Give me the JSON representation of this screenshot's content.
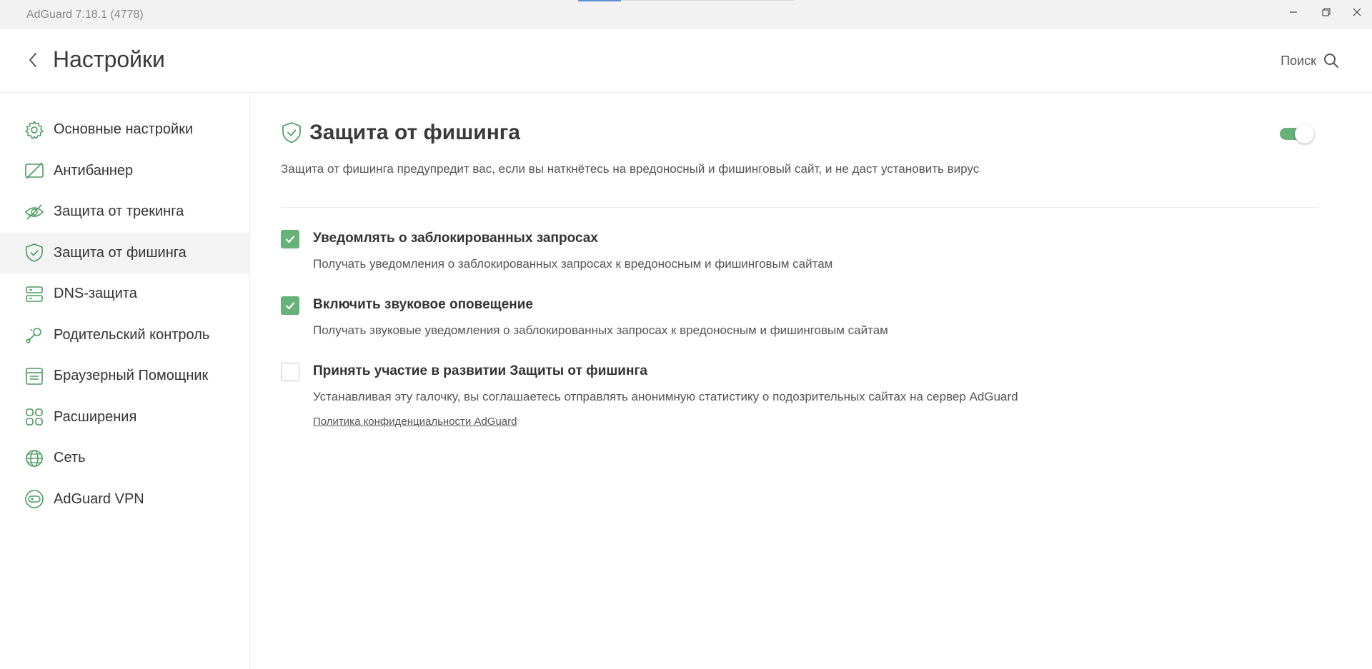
{
  "window": {
    "title": "AdGuard 7.18.1 (4778)",
    "controls": [
      "minimize-icon",
      "restore-icon",
      "close-icon"
    ]
  },
  "header": {
    "title": "Настройки",
    "back_icon": "chevron-left-icon",
    "search_label": "Поиск",
    "search_icon": "search-icon"
  },
  "sidebar": {
    "items": [
      {
        "label": "Основные настройки",
        "icon": "gear-icon",
        "active": false
      },
      {
        "label": "Антибаннер",
        "icon": "ad-block-icon",
        "active": false
      },
      {
        "label": "Защита от трекинга",
        "icon": "eye-off-icon",
        "active": false
      },
      {
        "label": "Защита от фишинга",
        "icon": "shield-check-icon",
        "active": true
      },
      {
        "label": "DNS-защита",
        "icon": "server-icon",
        "active": false
      },
      {
        "label": "Родительский контроль",
        "icon": "rattle-icon",
        "active": false
      },
      {
        "label": "Браузерный Помощник",
        "icon": "browser-icon",
        "active": false
      },
      {
        "label": "Расширения",
        "icon": "grid-icon",
        "active": false
      },
      {
        "label": "Сеть",
        "icon": "globe-icon",
        "active": false
      },
      {
        "label": "AdGuard VPN",
        "icon": "vpn-icon",
        "active": false
      }
    ]
  },
  "main": {
    "section_title": "Защита от фишинга",
    "section_icon": "shield-check-icon",
    "enabled": true,
    "description": "Защита от фишинга предупредит вас, если вы наткнётесь на вредоносный и фишинговый сайт, и не даст установить вирус",
    "options": [
      {
        "title": "Уведомлять о заблокированных запросах",
        "description": "Получать уведомления о заблокированных запросах к вредоносным и фишинговым сайтам",
        "checked": true
      },
      {
        "title": "Включить звуковое оповещение",
        "description": "Получать звуковые уведомления о заблокированных запросах к вредоносным и фишинговым сайтам",
        "checked": true
      },
      {
        "title": "Принять участие в развитии Защиты от фишинга",
        "description": "Устанавливая эту галочку, вы соглашаетесь отправлять анонимную статистику о подозрительных сайтах на сервер AdGuard",
        "link": "Политика конфиденциальности AdGuard",
        "checked": false
      }
    ]
  },
  "colors": {
    "accent": "#67b279",
    "icon_green": "#4c9a62",
    "active_bg": "#f3f3f3",
    "titlebar_bg": "#f2f2f2"
  }
}
